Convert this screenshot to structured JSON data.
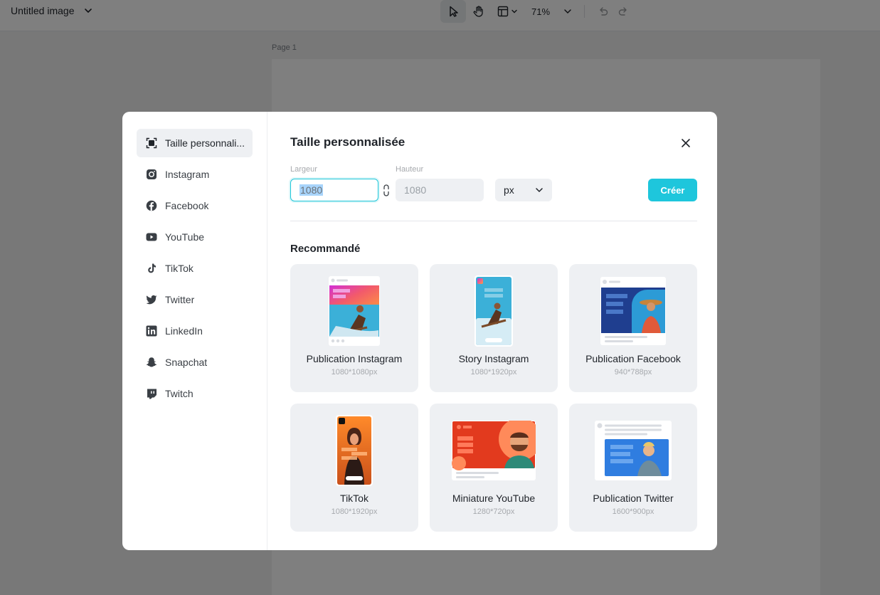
{
  "app": {
    "doc_title": "Untitled image",
    "zoom": "71%",
    "page_label": "Page 1"
  },
  "sidebar": {
    "items": [
      {
        "label": "Taille personnali...",
        "icon": "custom-size-icon"
      },
      {
        "label": "Instagram",
        "icon": "instagram-icon"
      },
      {
        "label": "Facebook",
        "icon": "facebook-icon"
      },
      {
        "label": "YouTube",
        "icon": "youtube-icon"
      },
      {
        "label": "TikTok",
        "icon": "tiktok-icon"
      },
      {
        "label": "Twitter",
        "icon": "twitter-icon"
      },
      {
        "label": "LinkedIn",
        "icon": "linkedin-icon"
      },
      {
        "label": "Snapchat",
        "icon": "snapchat-icon"
      },
      {
        "label": "Twitch",
        "icon": "twitch-icon"
      }
    ]
  },
  "dialog": {
    "title": "Taille personnalisée",
    "width_label": "Largeur",
    "width_value": "1080",
    "height_label": "Hauteur",
    "height_placeholder": "1080",
    "unit": "px",
    "create_label": "Créer",
    "recommended_title": "Recommandé"
  },
  "presets": [
    {
      "name": "Publication Instagram",
      "size": "1080*1080px"
    },
    {
      "name": "Story Instagram",
      "size": "1080*1920px"
    },
    {
      "name": "Publication Facebook",
      "size": "940*788px"
    },
    {
      "name": "TikTok",
      "size": "1080*1920px"
    },
    {
      "name": "Miniature YouTube",
      "size": "1280*720px"
    },
    {
      "name": "Publication Twitter",
      "size": "1600*900px"
    }
  ],
  "colors": {
    "accent": "#1ec6dc",
    "overlay": "rgba(0,0,0,0.5)",
    "card_bg": "#eef0f3"
  }
}
